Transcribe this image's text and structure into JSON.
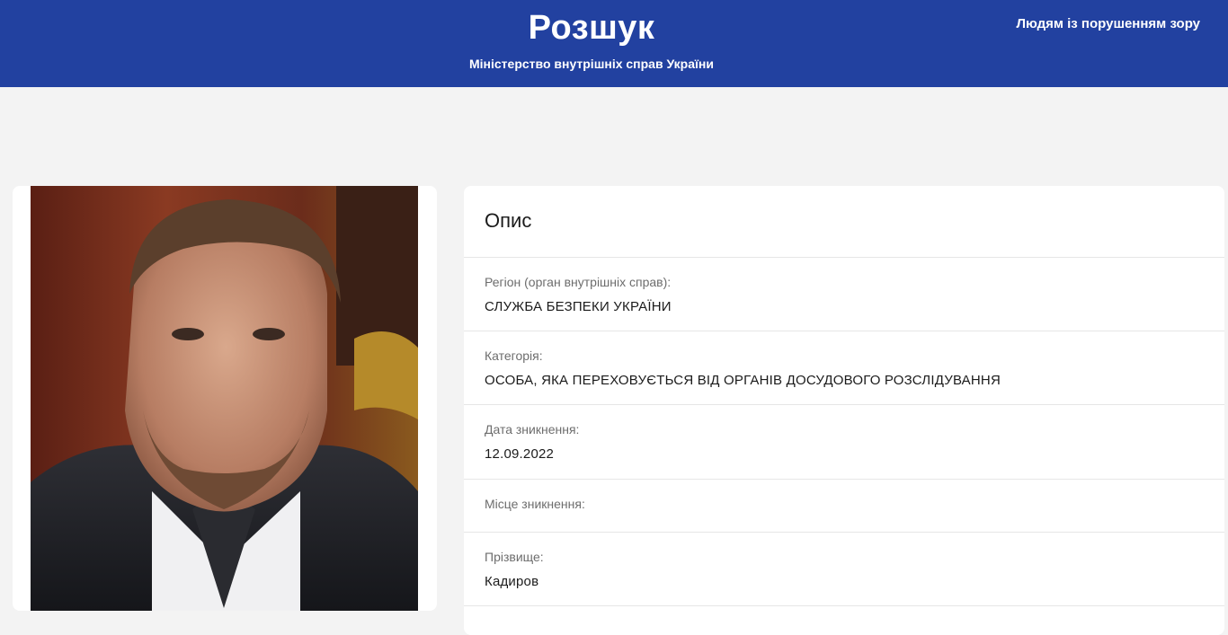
{
  "header": {
    "title": "Розшук",
    "subtitle": "Міністерство внутрішніх справ України",
    "accessibility_link": "Людям із порушенням зору",
    "background_color": "#2241a0"
  },
  "photo": {
    "alt": "photo"
  },
  "description": {
    "title": "Опис",
    "fields": [
      {
        "label": "Регіон (орган внутрішніх справ):",
        "value": "СЛУЖБА БЕЗПЕКИ УКРАЇНИ"
      },
      {
        "label": "Категорія:",
        "value": "ОСОБА, ЯКА ПЕРЕХОВУЄТЬСЯ ВІД ОРГАНІВ ДОСУДОВОГО РОЗСЛІДУВАННЯ"
      },
      {
        "label": "Дата зникнення:",
        "value": "12.09.2022"
      },
      {
        "label": "Місце зникнення:",
        "value": ""
      },
      {
        "label": "Прізвище:",
        "value": "Кадиров"
      }
    ]
  }
}
